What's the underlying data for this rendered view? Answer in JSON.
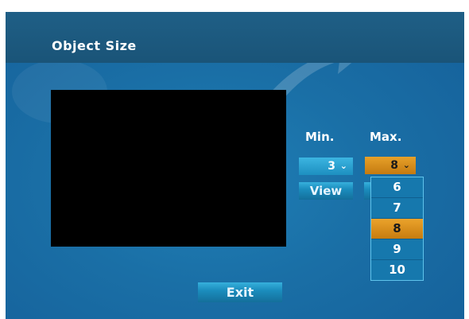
{
  "dialog": {
    "title": "Object Size"
  },
  "min": {
    "label": "Min.",
    "value": "3",
    "caret": "⌄"
  },
  "max": {
    "label": "Max.",
    "value": "8",
    "caret": "⌄",
    "options": [
      "6",
      "7",
      "8",
      "9",
      "10"
    ],
    "selected": "8"
  },
  "buttons": {
    "view": "View",
    "exit": "Exit"
  },
  "colors": {
    "accent": "#1a6fa6",
    "selection": "#d98b1a",
    "preview_bg": "#000000"
  }
}
